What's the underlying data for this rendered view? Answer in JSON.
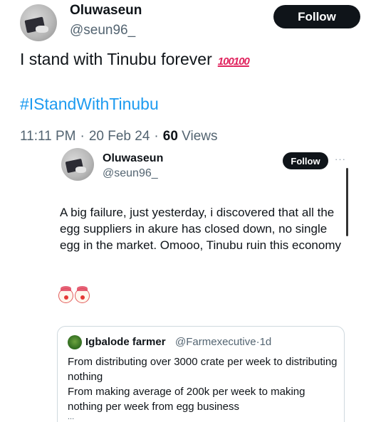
{
  "tweet": {
    "author_name": "Oluwaseun",
    "author_handle": "@seun96_",
    "follow_label": "Follow",
    "text": "I stand with Tinubu forever",
    "emoji": [
      "100",
      "100"
    ],
    "hashtag": "#IStandWithTinubu",
    "time": "11:11 PM",
    "date": "20 Feb 24",
    "views_count": "60",
    "views_label": "Views"
  },
  "quoted": {
    "author_name": "Oluwaseun",
    "author_handle": "@seun96_",
    "follow_label": "Follow",
    "more_label": "···",
    "text": "A big failure, just yesterday, i discovered that all the egg suppliers in akure has closed down, no single egg in the market. Omooo, Tinubu ruin this economy",
    "reaction_icons": [
      "clown-face-icon",
      "clown-face-icon"
    ]
  },
  "nested_quote": {
    "author_name": "Igbalode farmer",
    "author_handle": "@Farmexecutive",
    "separator": "·",
    "age": "1d",
    "line1": "From distributing over 3000 crate per week to distributing nothing",
    "line2": "From making average of 200k per week to making nothing per week from egg business",
    "ellipsis": "..."
  },
  "colors": {
    "link": "#1d9bf0",
    "secondary": "#536471",
    "button_bg": "#0f1419"
  }
}
